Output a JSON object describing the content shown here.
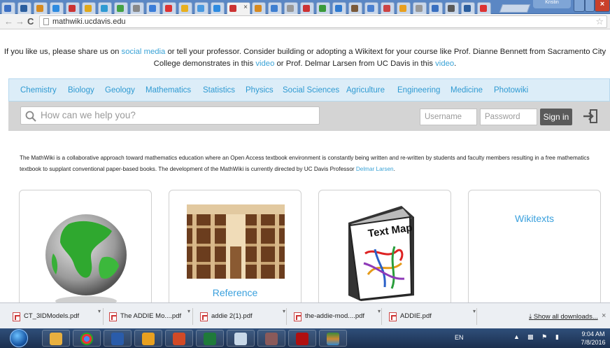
{
  "browser": {
    "url": "mathwiki.ucdavis.edu",
    "active_tab_close": "×",
    "user_badge": "Kristin",
    "close_glyph": "×"
  },
  "notice": {
    "part1": "If you like us, please share us on ",
    "link1": "social media",
    "part2": " or tell your professor. Consider building or adopting a Wikitext for your course like Prof. Dianne Bennett from Sacramento City College demonstrates in this ",
    "link2": "video",
    "part3": " or Prof. Delmar Larsen from UC Davis in this ",
    "link3": "video",
    "part4": "."
  },
  "categories": [
    "Chemistry",
    "Biology",
    "Geology",
    "Mathematics",
    "Statistics",
    "Physics",
    "Social Sciences",
    "Agriculture",
    "Engineering",
    "Medicine",
    "Photowiki"
  ],
  "search": {
    "placeholder": "How can we help you?"
  },
  "login": {
    "username_placeholder": "Username",
    "password_placeholder": "Password",
    "signin_label": "Sign in"
  },
  "intro": {
    "text": "The MathWiki is a collaborative approach toward mathematics education where an Open Access textbook environment is constantly being written and re-written by students and faculty members resulting in a free mathematics textbook to supplant conventional paper-based books. The development of the MathWiki is currently directed by UC Davis Professor ",
    "link": "Delmar Larsen",
    "end": "."
  },
  "cards": {
    "reference": "Reference",
    "wikitexts": "Wikitexts",
    "textmap_label": "Text Map"
  },
  "downloads": {
    "items": [
      "CT_3IDModels.pdf",
      "The ADDIE Mo....pdf",
      "addie 2(1).pdf",
      "the-addie-mod....pdf",
      "ADDIE.pdf"
    ],
    "show_all": "Show all downloads..."
  },
  "taskbar": {
    "lang": "EN",
    "time": "9:04 AM",
    "date": "7/8/2016"
  }
}
